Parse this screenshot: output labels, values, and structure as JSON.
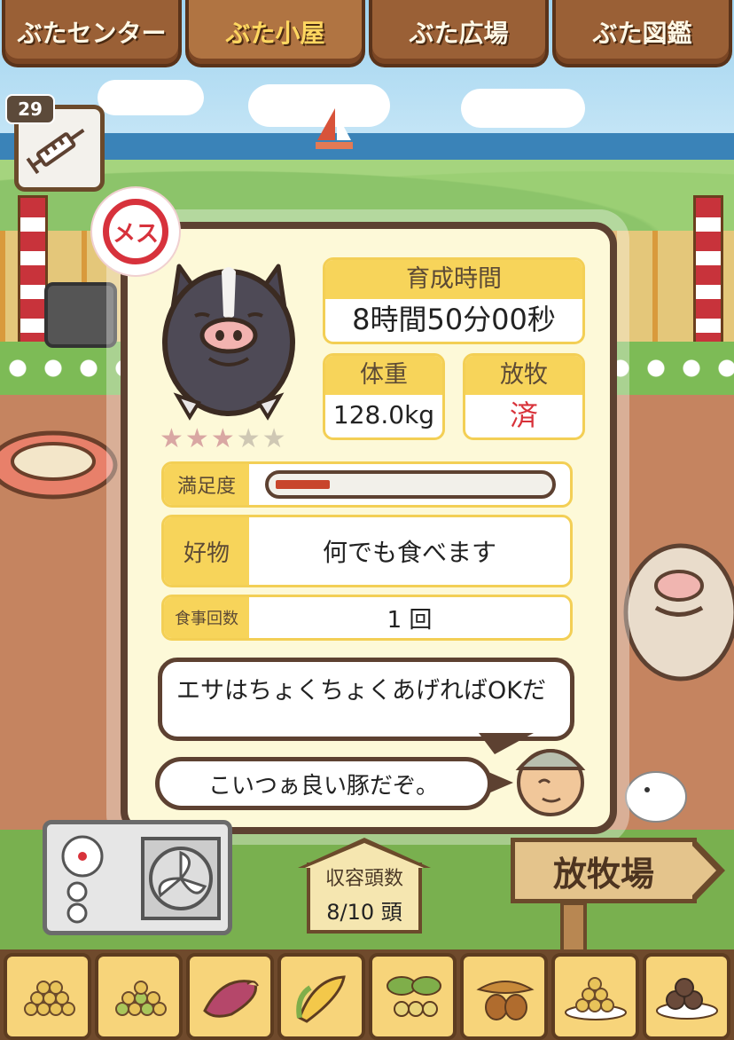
{
  "tabs": [
    {
      "label": "ぶたセンター"
    },
    {
      "label": "ぶた小屋"
    },
    {
      "label": "ぶた広場"
    },
    {
      "label": "ぶた図鑑"
    }
  ],
  "active_tab": "ぶた小屋",
  "injection": {
    "count": "29",
    "icon": "syringe-icon"
  },
  "pig": {
    "gender_label": "メス",
    "stars_filled": 3,
    "stars_total": 5,
    "stats": {
      "growth_time": {
        "label": "育成時間",
        "value": "8時間50分00秒"
      },
      "weight": {
        "label": "体重",
        "value": "128.0kg"
      },
      "grazing": {
        "label": "放牧",
        "value": "済"
      }
    },
    "satisfaction": {
      "label": "満足度",
      "level": 0.2
    },
    "favorite": {
      "label": "好物",
      "value": "何でも食べます"
    },
    "meals": {
      "label": "食事回数",
      "value": "1 回"
    }
  },
  "dialog": {
    "advice": "エサはちょくちょくあげればOKだ",
    "comment": "こいつぁ良い豚だぞ。"
  },
  "capacity": {
    "label": "収容頭数",
    "value": "8/10 頭"
  },
  "pasture_button": {
    "label": "放牧場"
  },
  "food_items": [
    {
      "icon": "grain-pile-icon"
    },
    {
      "icon": "mixed-grain-icon"
    },
    {
      "icon": "sweet-potato-icon"
    },
    {
      "icon": "corn-icon"
    },
    {
      "icon": "soybean-icon"
    },
    {
      "icon": "acorn-icon"
    },
    {
      "icon": "grain-plate-icon"
    },
    {
      "icon": "dumpling-plate-icon"
    }
  ],
  "colors": {
    "panel_border": "#5d4131",
    "label_bg": "#f7d45a",
    "accent_red": "#d8323a",
    "panel_bg": "#fdf9d8"
  }
}
